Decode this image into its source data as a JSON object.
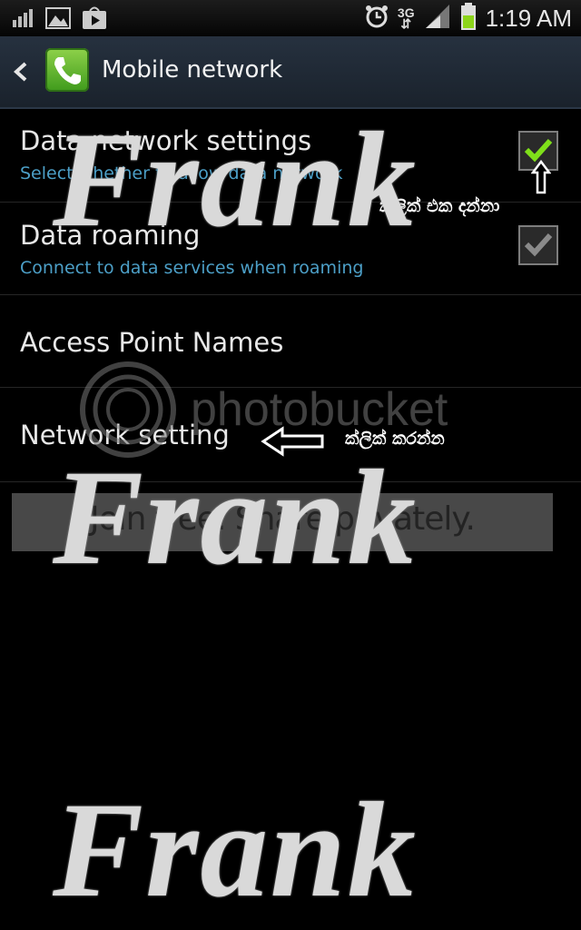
{
  "status_bar": {
    "time": "1:19 AM",
    "network_type": "3G",
    "icons": [
      "signal-bars-icon",
      "gallery-icon",
      "play-store-icon",
      "alarm-icon",
      "network-signal-icon",
      "battery-icon"
    ]
  },
  "action_bar": {
    "title": "Mobile network",
    "back_icon": "back-arrow-icon",
    "app_icon": "phone-app-icon"
  },
  "settings": [
    {
      "title": "Data network settings",
      "subtitle": "Select whether to allow data network",
      "checkbox": true,
      "checked_color": "#7fe01a"
    },
    {
      "title": "Data roaming",
      "subtitle": "Connect to data services when roaming",
      "checkbox": true,
      "checked_color": "#8a8a8a"
    },
    {
      "title": "Access Point Names",
      "subtitle": "",
      "checkbox": false
    },
    {
      "title": "Network setting",
      "subtitle": "",
      "checkbox": false
    }
  ],
  "annotations": {
    "tick_note": "ක්ලික් එක දන්නා",
    "click_note": "ක්ලික් කරන්න"
  },
  "watermarks": {
    "frank": "Frank",
    "photobucket": "photobucket",
    "banner": "Join free. Share privately."
  },
  "colors": {
    "accent_blue": "#4c9fc7",
    "action_bar": "#1e2733"
  }
}
